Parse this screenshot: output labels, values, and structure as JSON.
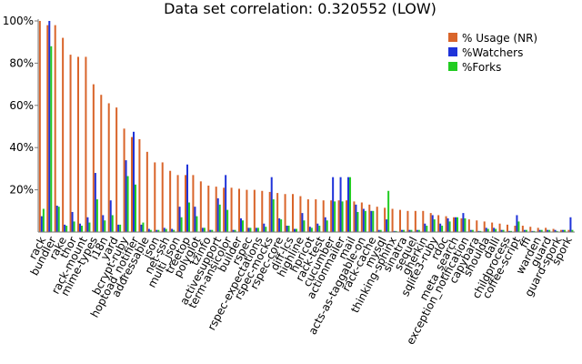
{
  "chart_data": {
    "type": "bar",
    "title": "Data set correlation: 0.320552 (LOW)",
    "xlabel": "",
    "ylabel": "",
    "ylim": [
      0,
      100
    ],
    "yticks": [
      "20%",
      "40%",
      "60%",
      "80%",
      "100%"
    ],
    "ytick_values": [
      20,
      40,
      60,
      80,
      100
    ],
    "grid": false,
    "legend_position": "top-right",
    "colors": {
      "usage": "#d9652b",
      "watchers": "#1f33d9",
      "forks": "#22cc22",
      "axis": "#7a7a7a"
    },
    "categories": [
      "rack",
      "bundler",
      "rake",
      "thor",
      "rack-mount",
      "mime-types",
      "i18n",
      "yard",
      "bcrypt-ruby",
      "hoptoad_notifier",
      "addressable",
      "json",
      "net-ssh",
      "multi_json",
      "treetop",
      "polyglot",
      "tzinfo",
      "activesupport",
      "term-ansicolor",
      "builder",
      "rspec",
      "rspec-expectations",
      "rspec-mocks",
      "rspec-core",
      "diff-lcs",
      "highline",
      "hpricot",
      "rack-test",
      "cucumber",
      "actionmailer",
      "mail",
      "acts-as-taggable-on",
      "rack-cache",
      "mysql",
      "thinking-sphinx",
      "sinatra",
      "sequel",
      "gherkin",
      "sqlite3-ruby",
      "rdoc",
      "meta_search",
      "exception_notification",
      "capybara",
      "shoulda",
      "dalli",
      "childprocess",
      "coffee-script",
      "ffi",
      "warden",
      "guard",
      "guard-spork",
      "spork"
    ],
    "series": [
      {
        "name": "% Usage (NR)",
        "values": [
          100,
          98,
          98,
          92,
          84,
          83,
          83,
          70,
          65,
          61,
          59,
          49,
          45,
          44,
          38,
          33,
          33,
          29,
          27,
          27,
          27,
          24,
          22,
          21.5,
          21,
          21,
          20.5,
          20,
          20,
          19.5,
          19,
          18.5,
          18,
          18,
          17,
          15.5,
          15.5,
          15,
          15,
          15,
          15,
          14.5,
          14,
          13,
          12,
          11.5,
          11,
          10.5,
          10,
          10,
          10,
          9,
          8,
          7.5,
          7,
          6.5,
          6,
          5.5,
          5,
          4.5,
          4,
          3.5,
          3,
          3,
          2.5,
          2,
          2,
          1.5,
          1,
          1
        ]
      },
      {
        "name": "%Watchers",
        "values": [
          7.5,
          100,
          12.5,
          3.5,
          9.5,
          4,
          7,
          28,
          8,
          15,
          3.5,
          34,
          47.5,
          3.5,
          1.5,
          1,
          2,
          1.5,
          12,
          32,
          12,
          2,
          1,
          16,
          27,
          1,
          6.5,
          2,
          2,
          4,
          26,
          6.5,
          3,
          1.5,
          9,
          2.5,
          4,
          7,
          26,
          26,
          26,
          13,
          11,
          10,
          1,
          6,
          0.5,
          1,
          1,
          1,
          4,
          8,
          4,
          6.5,
          7,
          9,
          1,
          0.5,
          2,
          2,
          1,
          0.5,
          8,
          1,
          0.5,
          1,
          1,
          1,
          1,
          7
        ]
      },
      {
        "name": "%Forks",
        "values": [
          11,
          88,
          12,
          3,
          5,
          3,
          4.5,
          15.5,
          5.5,
          8,
          3.5,
          26.5,
          22.5,
          4.5,
          1,
          1,
          1.5,
          1,
          7,
          14,
          7.5,
          2,
          1,
          13,
          10.5,
          1,
          5.5,
          2,
          2,
          2.5,
          15.5,
          6,
          3,
          1.5,
          5.5,
          2,
          3,
          5.5,
          14.5,
          14.5,
          26,
          9.5,
          10,
          10,
          1,
          19.5,
          0.5,
          1,
          1,
          1,
          3,
          6,
          3,
          5,
          7,
          6.5,
          1,
          0.5,
          1.5,
          1.5,
          1,
          0.5,
          5,
          1,
          0.5,
          1,
          1,
          0.5,
          1,
          1
        ]
      }
    ]
  }
}
